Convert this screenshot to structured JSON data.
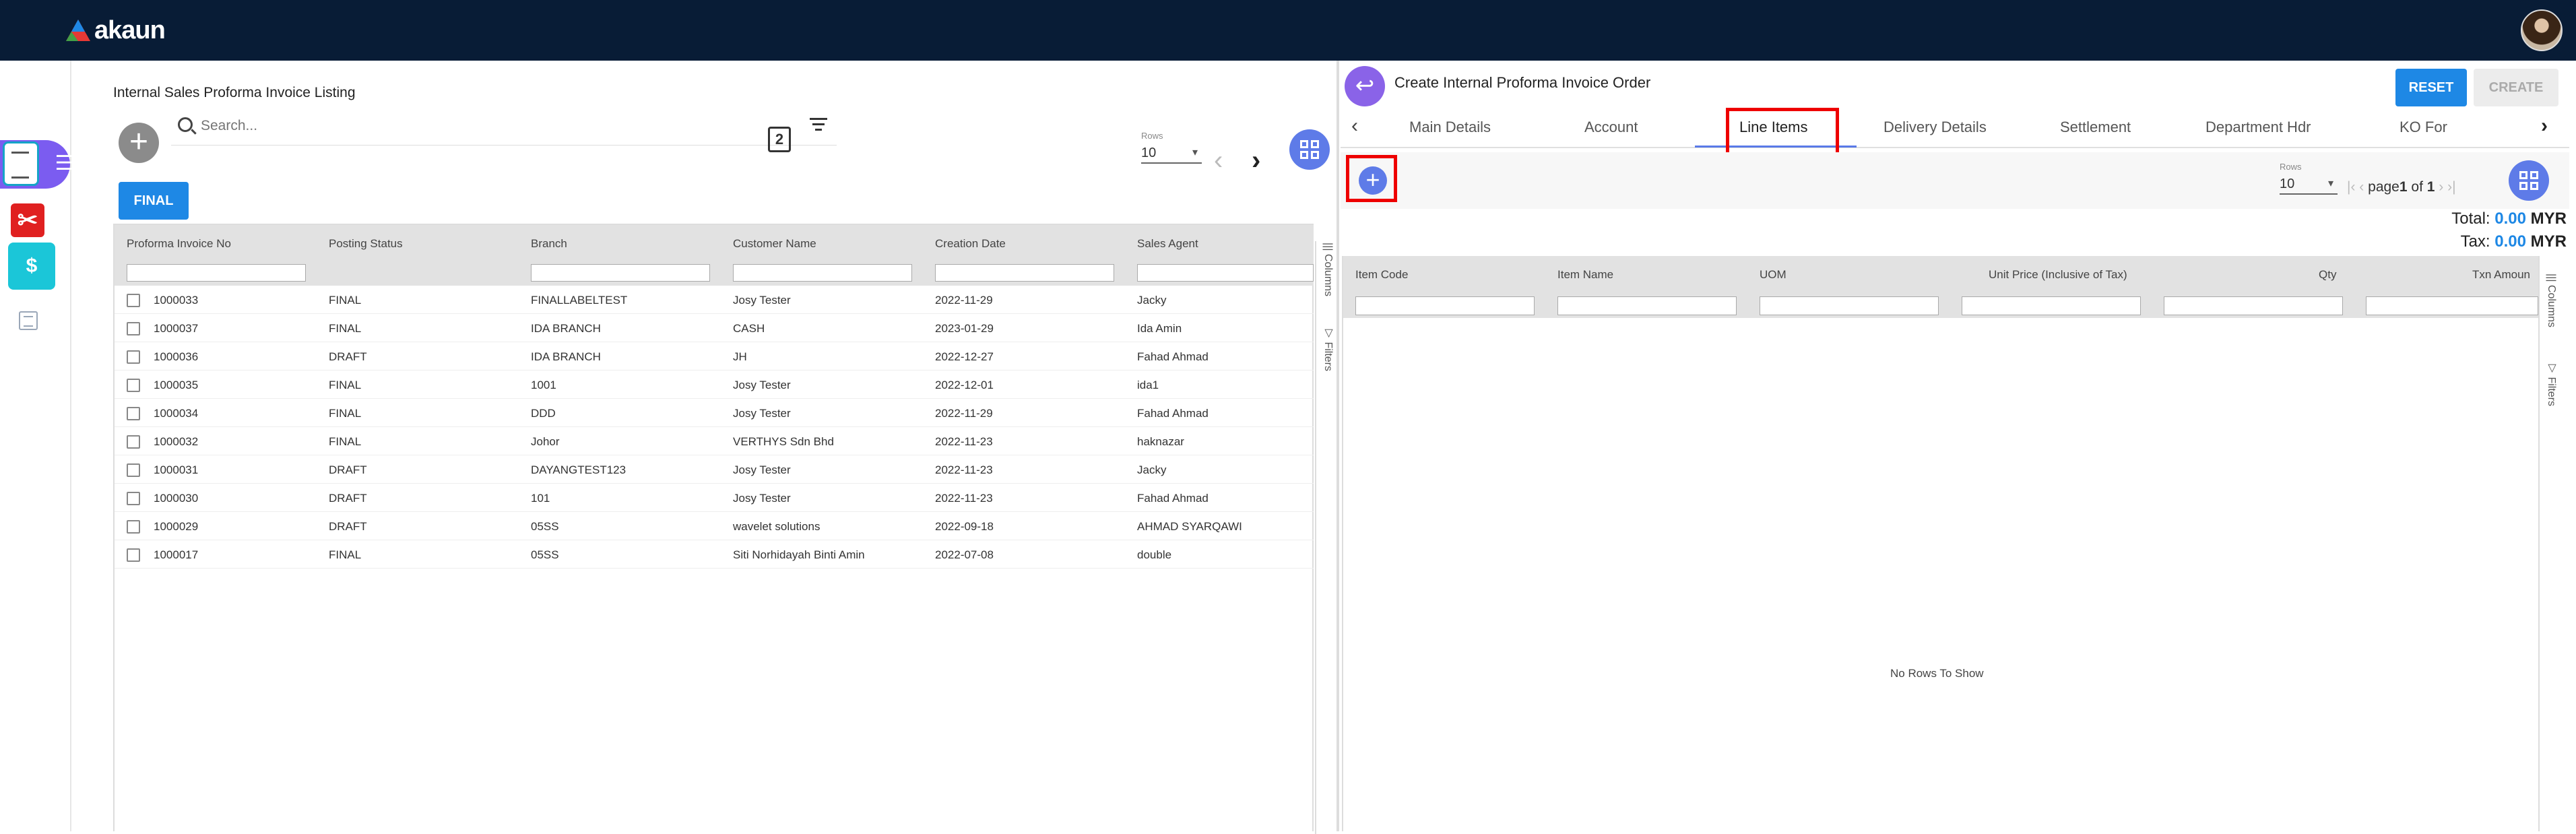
{
  "app": {
    "logo_text": "akaun",
    "brand_colors": {
      "navy": "#081c36",
      "primary": "#1e88e5",
      "accent": "#5e7be8",
      "highlight": "#e00000"
    }
  },
  "rail": {
    "icons": [
      "menu-icon",
      "document-app-icon",
      "pdf-app-icon",
      "invoice-app-icon",
      "list-icon"
    ],
    "invoice_app_glyph": "$",
    "pdf_app_glyph": "✂"
  },
  "listing": {
    "title": "Internal Sales Proforma Invoice Listing",
    "search_placeholder": "Search...",
    "export_glyph": "2",
    "rows_label": "Rows",
    "rows_value": "10",
    "final_button": "FINAL",
    "columns": [
      "Proforma Invoice No",
      "Posting Status",
      "Branch",
      "Customer Name",
      "Creation Date",
      "Sales Agent"
    ],
    "rows": [
      [
        "1000033",
        "FINAL",
        "FINALLABELTEST",
        "Josy Tester",
        "2022-11-29",
        "Jacky"
      ],
      [
        "1000037",
        "FINAL",
        "IDA BRANCH",
        "CASH",
        "2023-01-29",
        "Ida Amin"
      ],
      [
        "1000036",
        "DRAFT",
        "IDA BRANCH",
        "JH",
        "2022-12-27",
        "Fahad Ahmad"
      ],
      [
        "1000035",
        "FINAL",
        "1001",
        "Josy Tester",
        "2022-12-01",
        "ida1"
      ],
      [
        "1000034",
        "FINAL",
        "DDD",
        "Josy Tester",
        "2022-11-29",
        "Fahad Ahmad"
      ],
      [
        "1000032",
        "FINAL",
        "Johor",
        "VERTHYS Sdn Bhd",
        "2022-11-23",
        "haknazar"
      ],
      [
        "1000031",
        "DRAFT",
        "DAYANGTEST123",
        "Josy Tester",
        "2022-11-23",
        "Jacky"
      ],
      [
        "1000030",
        "DRAFT",
        "101",
        "Josy Tester",
        "2022-11-23",
        "Fahad Ahmad"
      ],
      [
        "1000029",
        "DRAFT",
        "05SS",
        "wavelet solutions",
        "2022-09-18",
        "AHMAD SYARQAWI"
      ],
      [
        "1000017",
        "FINAL",
        "05SS",
        "Siti Norhidayah Binti Amin",
        "2022-07-08",
        "double"
      ]
    ],
    "side_tabs": [
      "Columns",
      "Filters"
    ]
  },
  "order": {
    "title": "Create Internal Proforma Invoice Order",
    "reset_button": "RESET",
    "create_button": "CREATE",
    "tabs": [
      "Main Details",
      "Account",
      "Line Items",
      "Delivery Details",
      "Settlement",
      "Department Hdr",
      "KO For"
    ],
    "active_tab": "Line Items",
    "rows_label": "Rows",
    "rows_value": "10",
    "pager_text": "page",
    "pager_page": "1",
    "pager_of": "of",
    "pager_total": "1",
    "total_label": "Total:",
    "total_amount": "0.00",
    "tax_label": "Tax:",
    "tax_amount": "0.00",
    "currency": "MYR",
    "line_columns": [
      "Item Code",
      "Item Name",
      "UOM",
      "Unit Price (Inclusive of Tax)",
      "Qty",
      "Txn Amoun"
    ],
    "empty_text": "No Rows To Show",
    "side_tabs": [
      "Columns",
      "Filters"
    ]
  }
}
